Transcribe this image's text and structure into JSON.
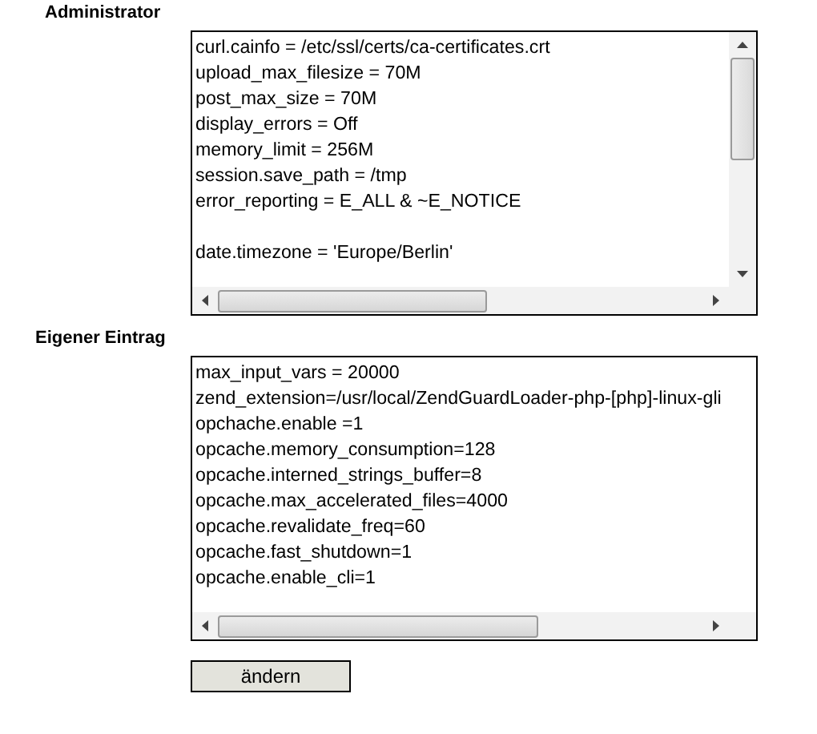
{
  "sections": [
    {
      "label": "Administrator",
      "vertical_scrollbar": true,
      "blocks": [
        [
          "curl.cainfo = /etc/ssl/certs/ca-certificates.crt",
          "upload_max_filesize = 70M",
          "post_max_size = 70M",
          "display_errors = Off",
          "memory_limit = 256M",
          "session.save_path = /tmp",
          "error_reporting = E_ALL & ~E_NOTICE"
        ],
        [
          "date.timezone = 'Europe/Berlin'"
        ]
      ]
    },
    {
      "label": "Eigener Eintrag",
      "vertical_scrollbar": false,
      "blocks": [
        [
          "max_input_vars = 20000",
          "zend_extension=/usr/local/ZendGuardLoader-php-[php]-linux-gli",
          "opchache.enable =1",
          "opcache.memory_consumption=128",
          "opcache.interned_strings_buffer=8",
          "opcache.max_accelerated_files=4000",
          "opcache.revalidate_freq=60",
          "opcache.fast_shutdown=1",
          "opcache.enable_cli=1"
        ]
      ]
    }
  ],
  "submit_button": "ändern"
}
